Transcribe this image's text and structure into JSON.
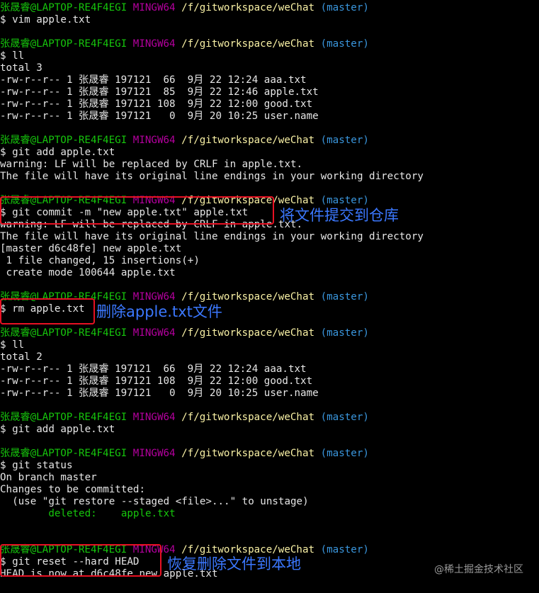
{
  "terminal": {
    "lines": [
      {
        "type": "prompt",
        "user": "张晟睿@LAPTOP-RE4F4EGI",
        "system": "MINGW64",
        "path": "/f/gitworkspace/weChat",
        "branch": "(master)"
      },
      {
        "type": "text",
        "text": "$ vim apple.txt"
      },
      {
        "type": "blank",
        "text": ""
      },
      {
        "type": "prompt",
        "user": "张晟睿@LAPTOP-RE4F4EGI",
        "system": "MINGW64",
        "path": "/f/gitworkspace/weChat",
        "branch": "(master)"
      },
      {
        "type": "text",
        "text": "$ ll"
      },
      {
        "type": "text",
        "text": "total 3"
      },
      {
        "type": "text",
        "text": "-rw-r--r-- 1 张晟睿 197121  66  9月 22 12:24 aaa.txt"
      },
      {
        "type": "text",
        "text": "-rw-r--r-- 1 张晟睿 197121  85  9月 22 12:46 apple.txt"
      },
      {
        "type": "text",
        "text": "-rw-r--r-- 1 张晟睿 197121 108  9月 22 12:00 good.txt"
      },
      {
        "type": "text",
        "text": "-rw-r--r-- 1 张晟睿 197121   0  9月 20 10:25 user.name"
      },
      {
        "type": "blank",
        "text": ""
      },
      {
        "type": "prompt",
        "user": "张晟睿@LAPTOP-RE4F4EGI",
        "system": "MINGW64",
        "path": "/f/gitworkspace/weChat",
        "branch": "(master)"
      },
      {
        "type": "text",
        "text": "$ git add apple.txt"
      },
      {
        "type": "text",
        "text": "warning: LF will be replaced by CRLF in apple.txt."
      },
      {
        "type": "text",
        "text": "The file will have its original line endings in your working directory"
      },
      {
        "type": "blank",
        "text": ""
      },
      {
        "type": "prompt",
        "user": "张晟睿@LAPTOP-RE4F4EGI",
        "system": "MINGW64",
        "path": "/f/gitworkspace/weChat",
        "branch": "(master)"
      },
      {
        "type": "text",
        "text": "$ git commit -m \"new apple.txt\" apple.txt"
      },
      {
        "type": "text",
        "text": "warning: LF will be replaced by CRLF in apple.txt."
      },
      {
        "type": "text",
        "text": "The file will have its original line endings in your working directory"
      },
      {
        "type": "text",
        "text": "[master d6c48fe] new apple.txt"
      },
      {
        "type": "text",
        "text": " 1 file changed, 15 insertions(+)"
      },
      {
        "type": "text",
        "text": " create mode 100644 apple.txt"
      },
      {
        "type": "blank",
        "text": ""
      },
      {
        "type": "prompt",
        "user": "张晟睿@LAPTOP-RE4F4EGI",
        "system": "MINGW64",
        "path": "/f/gitworkspace/weChat",
        "branch": "(master)"
      },
      {
        "type": "text",
        "text": "$ rm apple.txt"
      },
      {
        "type": "blank",
        "text": ""
      },
      {
        "type": "prompt",
        "user": "张晟睿@LAPTOP-RE4F4EGI",
        "system": "MINGW64",
        "path": "/f/gitworkspace/weChat",
        "branch": "(master)"
      },
      {
        "type": "text",
        "text": "$ ll"
      },
      {
        "type": "text",
        "text": "total 2"
      },
      {
        "type": "text",
        "text": "-rw-r--r-- 1 张晟睿 197121  66  9月 22 12:24 aaa.txt"
      },
      {
        "type": "text",
        "text": "-rw-r--r-- 1 张晟睿 197121 108  9月 22 12:00 good.txt"
      },
      {
        "type": "text",
        "text": "-rw-r--r-- 1 张晟睿 197121   0  9月 20 10:25 user.name"
      },
      {
        "type": "blank",
        "text": ""
      },
      {
        "type": "prompt",
        "user": "张晟睿@LAPTOP-RE4F4EGI",
        "system": "MINGW64",
        "path": "/f/gitworkspace/weChat",
        "branch": "(master)"
      },
      {
        "type": "text",
        "text": "$ git add apple.txt"
      },
      {
        "type": "blank",
        "text": ""
      },
      {
        "type": "prompt",
        "user": "张晟睿@LAPTOP-RE4F4EGI",
        "system": "MINGW64",
        "path": "/f/gitworkspace/weChat",
        "branch": "(master)"
      },
      {
        "type": "text",
        "text": "$ git status"
      },
      {
        "type": "text",
        "text": "On branch master"
      },
      {
        "type": "text",
        "text": "Changes to be committed:"
      },
      {
        "type": "text",
        "text": "  (use \"git restore --staged <file>...\" to unstage)"
      },
      {
        "type": "deleted",
        "label": "        deleted:    ",
        "file": "apple.txt"
      },
      {
        "type": "blank",
        "text": ""
      },
      {
        "type": "blank",
        "text": ""
      },
      {
        "type": "prompt",
        "user": "张晟睿@LAPTOP-RE4F4EGI",
        "system": "MINGW64",
        "path": "/f/gitworkspace/weChat",
        "branch": "(master)"
      },
      {
        "type": "text",
        "text": "$ git reset --hard HEAD"
      },
      {
        "type": "text",
        "text": "HEAD is now at d6c48fe new apple.txt"
      }
    ]
  },
  "annotations": {
    "commit_note": "将文件提交到仓库",
    "rm_note": "删除apple.txt文件",
    "reset_note": "恢复删除文件到本地"
  },
  "watermark": "@稀土掘金技术社区",
  "colors": {
    "background": "#000000",
    "text": "#e6e6e6",
    "prompt_user": "#16c60c",
    "prompt_system": "#b4009e",
    "prompt_path": "#f9f1a5",
    "prompt_branch": "#3a96dd",
    "highlight_box": "#e81123",
    "annotation_text": "#3b78ff"
  }
}
